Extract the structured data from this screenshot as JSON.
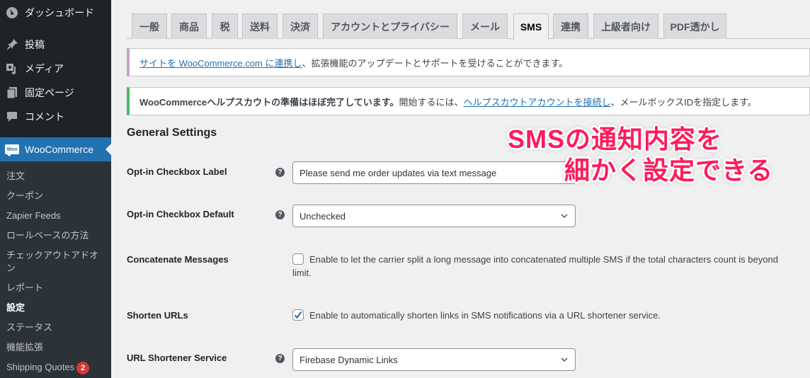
{
  "sidebar": {
    "top_items": [
      {
        "label": "ダッシュボード",
        "icon": "dashboard-icon"
      },
      {
        "label": "投稿",
        "icon": "pin-icon"
      },
      {
        "label": "メディア",
        "icon": "media-icon"
      },
      {
        "label": "固定ページ",
        "icon": "pages-icon"
      },
      {
        "label": "コメント",
        "icon": "comment-icon"
      },
      {
        "label": "WooCommerce",
        "icon": "woocommerce-icon",
        "logo_text": "Woo"
      }
    ],
    "submenu": [
      {
        "label": "注文"
      },
      {
        "label": "クーポン"
      },
      {
        "label": "Zapier Feeds"
      },
      {
        "label": "ロールベースの方法"
      },
      {
        "label": "チェックアウトアドオン"
      },
      {
        "label": "レポート"
      },
      {
        "label": "設定",
        "current": true
      },
      {
        "label": "ステータス"
      },
      {
        "label": "機能拡張"
      },
      {
        "label": "Shipping Quotes",
        "badge": "2"
      }
    ]
  },
  "tabs": [
    {
      "label": "一般"
    },
    {
      "label": "商品"
    },
    {
      "label": "税"
    },
    {
      "label": "送料"
    },
    {
      "label": "決済"
    },
    {
      "label": "アカウントとプライバシー"
    },
    {
      "label": "メール"
    },
    {
      "label": "SMS",
      "active": true
    },
    {
      "label": "連携"
    },
    {
      "label": "上級者向け"
    },
    {
      "label": "PDF透かし"
    }
  ],
  "notices": {
    "connect": {
      "link": "サイトを WooCommerce.com に連携し",
      "text": "、拡張機能のアップデートとサポートを受けることができます。",
      "color": "#c9a0cc"
    },
    "helpscout": {
      "bold": "WooCommerceヘルプスカウトの準備はほぼ完了しています。",
      "text1": "開始するには、",
      "link": "ヘルプスカウトアカウントを接続し",
      "text2": "、メールボックスIDを指定します。",
      "color": "#4ab866"
    }
  },
  "section_title": "General Settings",
  "settings": {
    "optin_label": {
      "label": "Opt-in Checkbox Label",
      "value": "Please send me order updates via text message"
    },
    "optin_default": {
      "label": "Opt-in Checkbox Default",
      "value": "Unchecked"
    },
    "concatenate": {
      "label": "Concatenate Messages",
      "checked": false,
      "text": "Enable to let the carrier split a long message into concatenated multiple SMS if the total characters count is beyond",
      "text_line2": "limit."
    },
    "shorten_urls": {
      "label": "Shorten URLs",
      "checked": true,
      "text": "Enable to automatically shorten links in SMS notifications via a URL shortener service."
    },
    "shortener_service": {
      "label": "URL Shortener Service",
      "value": "Firebase Dynamic Links"
    }
  },
  "overlay": {
    "line1": "SMSの通知内容を",
    "line2": "細かく設定できる"
  },
  "help_glyph": "?"
}
